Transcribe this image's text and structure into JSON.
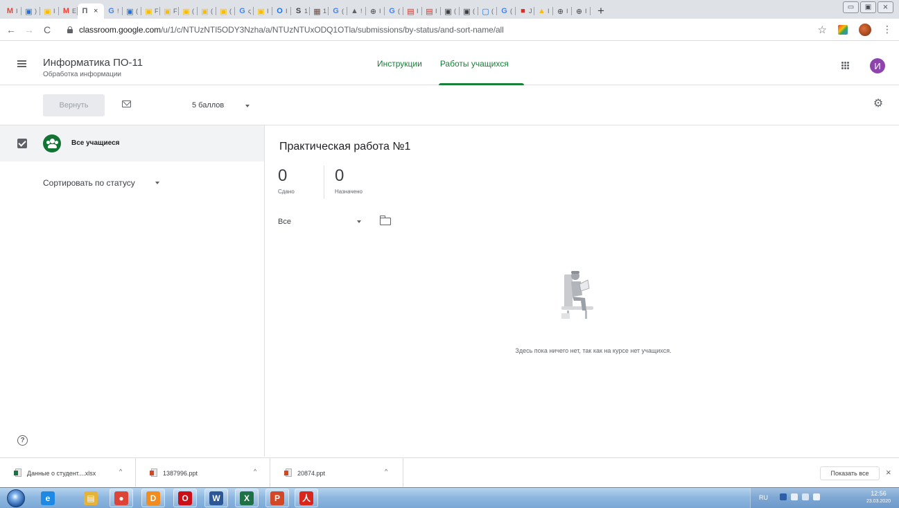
{
  "browser": {
    "tabs": [
      {
        "letter": "M",
        "color": "#ea4335",
        "label": "I"
      },
      {
        "letter": "▣",
        "color": "#1a73e8",
        "label": ")"
      },
      {
        "letter": "▣",
        "color": "#fbbc04",
        "label": "I"
      },
      {
        "letter": "M",
        "color": "#ea4335",
        "label": "E"
      },
      {
        "letter": "П",
        "color": "#5f6368",
        "label": "",
        "active": true,
        "close": "×"
      },
      {
        "letter": "G",
        "color": "#4285f4",
        "label": "!"
      },
      {
        "letter": "▣",
        "color": "#1a73e8",
        "label": "("
      },
      {
        "letter": "▣",
        "color": "#fbbc04",
        "label": "F"
      },
      {
        "letter": "▣",
        "color": "#fbbc04",
        "label": "F"
      },
      {
        "letter": "▣",
        "color": "#fbbc04",
        "label": "("
      },
      {
        "letter": "▣",
        "color": "#fbbc04",
        "label": "("
      },
      {
        "letter": "▣",
        "color": "#fbbc04",
        "label": "("
      },
      {
        "letter": "G",
        "color": "#4285f4",
        "label": "ς"
      },
      {
        "letter": "▣",
        "color": "#fbbc04",
        "label": "I"
      },
      {
        "letter": "O",
        "color": "#1a73e8",
        "label": "I"
      },
      {
        "letter": "S",
        "color": "#3c4043",
        "label": "1"
      },
      {
        "letter": "▦",
        "color": "#6d4c41",
        "label": "1"
      },
      {
        "letter": "G",
        "color": "#4285f4",
        "label": "("
      },
      {
        "letter": "▲",
        "color": "#5f6368",
        "label": "!"
      },
      {
        "letter": "⊕",
        "color": "#5f6368",
        "label": "I"
      },
      {
        "letter": "G",
        "color": "#4285f4",
        "label": "("
      },
      {
        "letter": "▤",
        "color": "#d93025",
        "label": "I"
      },
      {
        "letter": "▤",
        "color": "#d93025",
        "label": "I"
      },
      {
        "letter": "▣",
        "color": "#3c4043",
        "label": "("
      },
      {
        "letter": "▣",
        "color": "#3c4043",
        "label": "("
      },
      {
        "letter": "▢",
        "color": "#1a73e8",
        "label": "("
      },
      {
        "letter": "G",
        "color": "#4285f4",
        "label": "("
      },
      {
        "letter": "■",
        "color": "#d93025",
        "label": "J"
      },
      {
        "letter": "▲",
        "color": "#fbbc04",
        "label": "I"
      },
      {
        "letter": "⊕",
        "color": "#5f6368",
        "label": "I"
      },
      {
        "letter": "⊕",
        "color": "#5f6368",
        "label": "I"
      }
    ],
    "new_tab": "+",
    "window_controls": [
      "▭",
      "▣",
      "⨯"
    ],
    "back": "←",
    "forward": "→",
    "reload": "C",
    "url_host": "classroom.google.com",
    "url_path": "/u/1/c/NTUzNTI5ODY3Nzha/a/NTUzNTUxODQ1OTla/submissions/by-status/and-sort-name/all",
    "bookmark_star": "☆",
    "menu": "⋮"
  },
  "header": {
    "course_title": "Информатика ПО-11",
    "course_subtitle": "Обработка информации",
    "tabs": [
      {
        "label": "Инструкции",
        "active": false
      },
      {
        "label": "Работы учащихся",
        "active": true
      }
    ],
    "avatar_letter": "И",
    "accent_color": "#188038"
  },
  "toolbar": {
    "return_label": "Вернуть",
    "points_label": "5 баллов",
    "gear": "⚙"
  },
  "sidebar": {
    "all_students_label": "Все учащиеся",
    "sort_label": "Сортировать по статусу",
    "help": "?"
  },
  "assignment": {
    "title": "Практическая работа №1",
    "turned_in_count": "0",
    "turned_in_label": "Сдано",
    "assigned_count": "0",
    "assigned_label": "Назначено",
    "filter_value": "Все",
    "empty_message": "Здесь пока ничего нет, так как на курсе нет учащихся."
  },
  "downloads": {
    "items": [
      {
        "name": "Данные о студент....xlsx",
        "badge": "#1e7145"
      },
      {
        "name": "1387996.ppt",
        "badge": "#d24726"
      },
      {
        "name": "20874.ppt",
        "badge": "#d24726"
      }
    ],
    "up_arrow": "^",
    "show_all": "Показать все",
    "close": "×"
  },
  "taskbar": {
    "apps": [
      {
        "name": "ie",
        "glyph": "e",
        "color": "#1e88e5"
      },
      {
        "name": "explorer",
        "glyph": "▤",
        "color": "#e6b33a"
      },
      {
        "name": "chrome",
        "glyph": "●",
        "color": "#db4437"
      },
      {
        "name": "flash",
        "glyph": "D",
        "color": "#f28c1e"
      },
      {
        "name": "opera",
        "glyph": "O",
        "color": "#cc0f16"
      },
      {
        "name": "word",
        "glyph": "W",
        "color": "#2b5797"
      },
      {
        "name": "excel",
        "glyph": "X",
        "color": "#1e7145"
      },
      {
        "name": "powerpoint",
        "glyph": "P",
        "color": "#d24726"
      },
      {
        "name": "acrobat",
        "glyph": "人",
        "color": "#d9261c"
      }
    ],
    "lang": "RU",
    "time": "12:56",
    "date": "23.03.2020"
  }
}
